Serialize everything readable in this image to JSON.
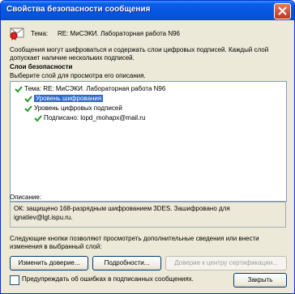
{
  "window": {
    "title": "Свойства безопасности сообщения"
  },
  "subject": {
    "label": "Тема:",
    "value": "RE: МиСЭКИ. Лабораторная работа N96"
  },
  "intro_text": "Сообщения могут шифроваться и содержать слои цифровых подписей. Каждый слой допускает наличие нескольких подписей.",
  "layers": {
    "heading": "Слои безопасности",
    "hint": "Выберите слой для просмотра его описания.",
    "tree": [
      {
        "label": "Тема: RE: МиСЭКИ. Лабораторная работа N96",
        "selected": false
      },
      {
        "label": "Уровень шифрования",
        "selected": true
      },
      {
        "label": "Уровень цифровых подписей",
        "selected": false
      },
      {
        "label": "Подписано: lopd_mohapx@mail.ru",
        "selected": false
      }
    ]
  },
  "description": {
    "label": "Описание:",
    "text": "ОК: защищено 168-разрядным шифрованием 3DES. Зашифровано для ignatiev@lgt.ispu.ru."
  },
  "info_text": "Следующие кнопки позволяют просмотреть дополнительные сведения или внести изменения в выбранный слой:",
  "buttons": {
    "change_trust": "Изменить доверие...",
    "details": "Подробности...",
    "trust_ca": "Доверие к центру сертификации..."
  },
  "warn_checkbox": {
    "label": "Предупреждать об ошибках в подписанных сообщениях.",
    "checked": false
  },
  "close_button": "Закрыть"
}
